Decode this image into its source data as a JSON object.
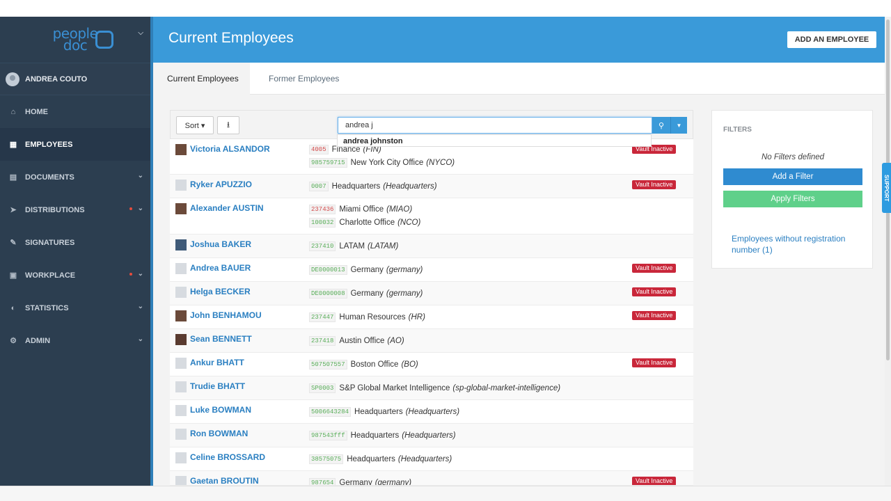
{
  "logo": {
    "line1": "people",
    "line2": "doc"
  },
  "sidebar": {
    "user": "ANDREA COUTO",
    "items": [
      {
        "label": "HOME",
        "icon": "home-icon"
      },
      {
        "label": "EMPLOYEES",
        "icon": "employees-icon"
      },
      {
        "label": "DOCUMENTS",
        "icon": "documents-icon"
      },
      {
        "label": "DISTRIBUTIONS",
        "icon": "send-icon"
      },
      {
        "label": "SIGNATURES",
        "icon": "signature-icon"
      },
      {
        "label": "WORKPLACE",
        "icon": "workplace-icon"
      },
      {
        "label": "STATISTICS",
        "icon": "statistics-icon"
      },
      {
        "label": "ADMIN",
        "icon": "gear-icon"
      }
    ]
  },
  "header": {
    "title": "Current Employees",
    "add_button": "ADD AN EMPLOYEE"
  },
  "tabs": [
    {
      "label": "Current Employees"
    },
    {
      "label": "Former Employees"
    }
  ],
  "toolbar": {
    "sort_label": "Sort ▾",
    "search_value": "andrea j",
    "suggestion": "andrea johnston"
  },
  "vault_label": "Vault Inactive",
  "employees": [
    {
      "name": "Victoria ALSANDOR",
      "sites": [
        {
          "code": "4005",
          "site": "Finance",
          "site_code": "(FIN)"
        },
        {
          "code": "985759715",
          "site": "New York City Office",
          "site_code": "(NYCO)"
        }
      ]
    },
    {
      "name": "Ryker APUZZIO",
      "sites": [
        {
          "code": "0007",
          "site": "Headquarters",
          "site_code": "(Headquarters)"
        }
      ]
    },
    {
      "name": "Alexander AUSTIN",
      "sites": [
        {
          "code": "237436",
          "site": "Miami Office",
          "site_code": "(MIAO)"
        },
        {
          "code": "100032",
          "site": "Charlotte Office",
          "site_code": "(NCO)"
        }
      ]
    },
    {
      "name": "Joshua BAKER",
      "sites": [
        {
          "code": "237410",
          "site": "LATAM",
          "site_code": "(LATAM)"
        }
      ]
    },
    {
      "name": "Andrea BAUER",
      "sites": [
        {
          "code": "DE0000013",
          "site": "Germany",
          "site_code": "(germany)"
        }
      ]
    },
    {
      "name": "Helga BECKER",
      "sites": [
        {
          "code": "DE0000008",
          "site": "Germany",
          "site_code": "(germany)"
        }
      ]
    },
    {
      "name": "John BENHAMOU",
      "sites": [
        {
          "code": "237447",
          "site": "Human Resources",
          "site_code": "(HR)"
        }
      ]
    },
    {
      "name": "Sean BENNETT",
      "sites": [
        {
          "code": "237418",
          "site": "Austin Office",
          "site_code": "(AO)"
        }
      ]
    },
    {
      "name": "Ankur BHATT",
      "sites": [
        {
          "code": "507507557",
          "site": "Boston Office",
          "site_code": "(BO)"
        }
      ]
    },
    {
      "name": "Trudie BHATT",
      "sites": [
        {
          "code": "SP0003",
          "site": "S&P Global Market Intelligence",
          "site_code": "(sp-global-market-intelligence)"
        }
      ]
    },
    {
      "name": "Luke BOWMAN",
      "sites": [
        {
          "code": "5006643284",
          "site": "Headquarters",
          "site_code": "(Headquarters)"
        }
      ]
    },
    {
      "name": "Ron BOWMAN",
      "sites": [
        {
          "code": "987543fff",
          "site": "Headquarters",
          "site_code": "(Headquarters)"
        }
      ]
    },
    {
      "name": "Celine BROSSARD",
      "sites": [
        {
          "code": "38575075",
          "site": "Headquarters",
          "site_code": "(Headquarters)"
        }
      ]
    },
    {
      "name": "Gaetan BROUTIN",
      "sites": [
        {
          "code": "987654",
          "site": "Germany",
          "site_code": "(germany)"
        }
      ]
    }
  ],
  "filters": {
    "title": "FILTERS",
    "empty": "No Filters defined",
    "add": "Add a Filter",
    "apply": "Apply Filters",
    "no_registration": "Employees without registration number (1)"
  },
  "support_label": "SUPPORT",
  "colors": {
    "sidebar": "#2c3e50",
    "header": "#3a9ad9",
    "link": "#2a7fc1",
    "vault": "#c9273a",
    "apply": "#5fd08a"
  }
}
